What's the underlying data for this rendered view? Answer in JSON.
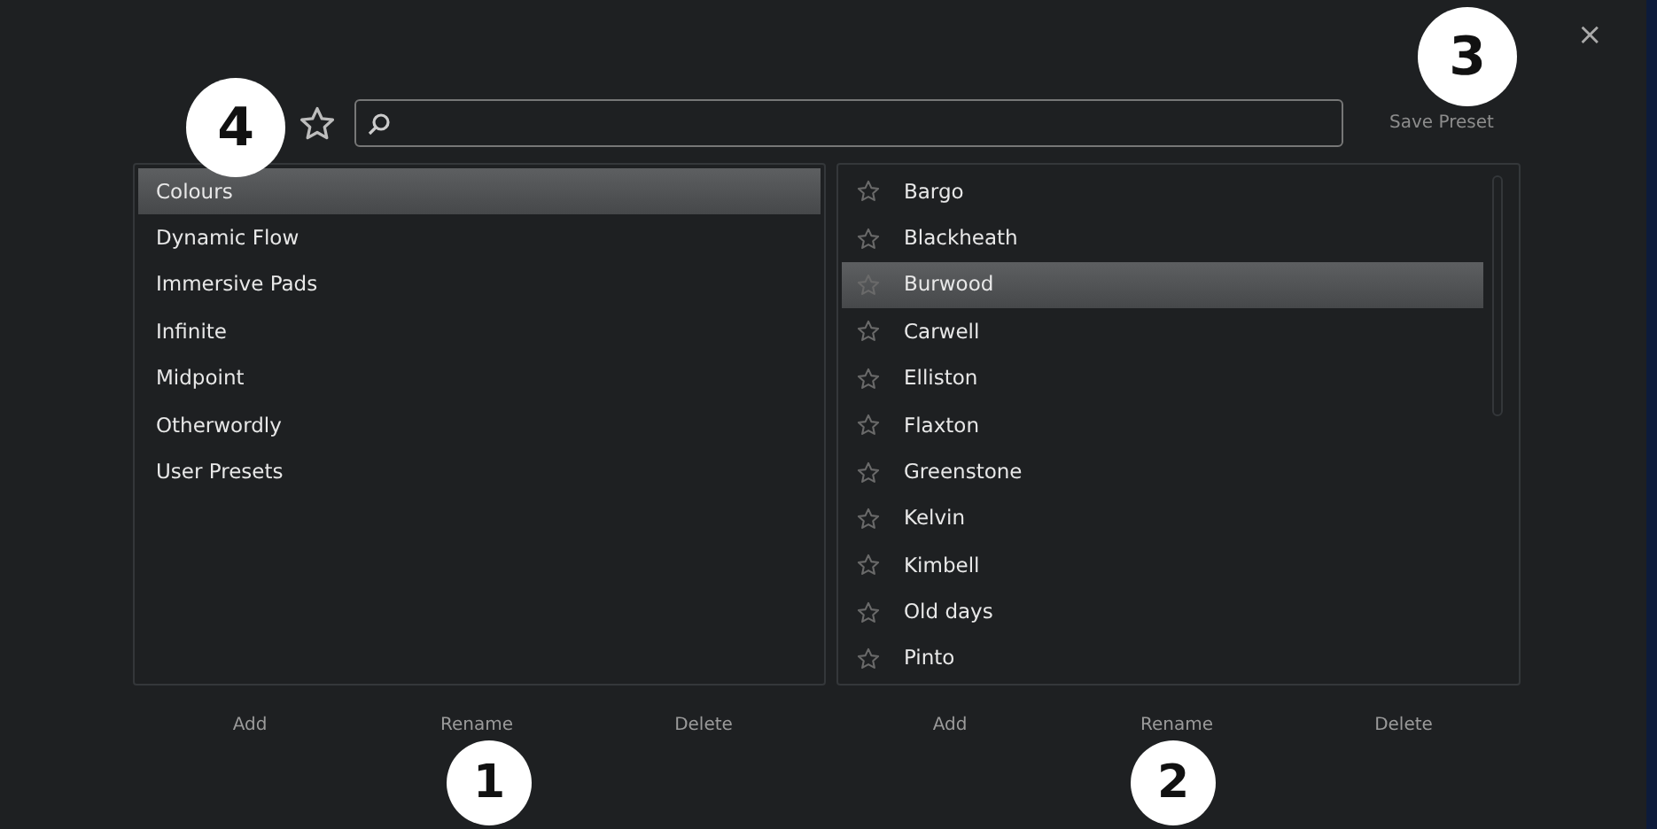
{
  "dialog": {
    "close": "×"
  },
  "search": {
    "favorites_only": false
  },
  "save_preset": "Save Preset",
  "categories": [
    {
      "label": "Colours",
      "selected": true
    },
    {
      "label": "Dynamic Flow",
      "selected": false
    },
    {
      "label": "Immersive Pads",
      "selected": false
    },
    {
      "label": "Infinite",
      "selected": false
    },
    {
      "label": "Midpoint",
      "selected": false
    },
    {
      "label": "Otherwordly",
      "selected": false
    },
    {
      "label": "User Presets",
      "selected": false
    }
  ],
  "presets": [
    {
      "label": "Bargo",
      "selected": false,
      "favorite": false
    },
    {
      "label": "Blackheath",
      "selected": false,
      "favorite": false
    },
    {
      "label": "Burwood",
      "selected": true,
      "favorite": false
    },
    {
      "label": "Carwell",
      "selected": false,
      "favorite": false
    },
    {
      "label": "Elliston",
      "selected": false,
      "favorite": false
    },
    {
      "label": "Flaxton",
      "selected": false,
      "favorite": false
    },
    {
      "label": "Greenstone",
      "selected": false,
      "favorite": false
    },
    {
      "label": "Kelvin",
      "selected": false,
      "favorite": false
    },
    {
      "label": "Kimbell",
      "selected": false,
      "favorite": false
    },
    {
      "label": "Old days",
      "selected": false,
      "favorite": false
    },
    {
      "label": "Pinto",
      "selected": false,
      "favorite": false
    }
  ],
  "category_buttons": [
    "Add",
    "Rename",
    "Delete"
  ],
  "preset_buttons": [
    "Add",
    "Rename",
    "Delete"
  ],
  "callouts": [
    {
      "label": "1"
    },
    {
      "label": "2"
    },
    {
      "label": "3"
    },
    {
      "label": "4"
    }
  ]
}
